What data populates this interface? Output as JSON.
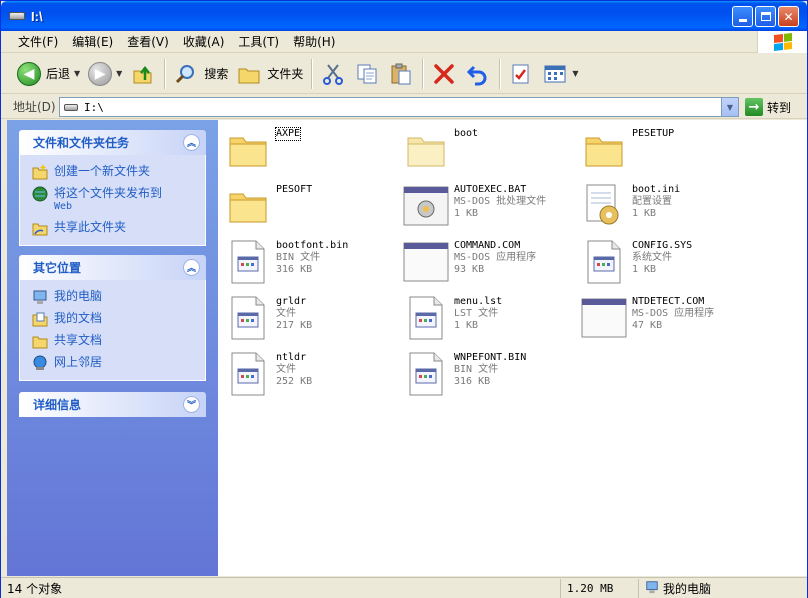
{
  "window": {
    "title": "I:\\"
  },
  "menu": [
    "文件(F)",
    "编辑(E)",
    "查看(V)",
    "收藏(A)",
    "工具(T)",
    "帮助(H)"
  ],
  "toolbar": {
    "back_label": "后退",
    "search_label": "搜索",
    "folders_label": "文件夹"
  },
  "address": {
    "label": "地址(D)",
    "value": "I:\\",
    "go_label": "转到"
  },
  "left": {
    "tasks": {
      "title": "文件和文件夹任务",
      "items": [
        {
          "label": "创建一个新文件夹",
          "sub": "",
          "icon": "new-folder-icon"
        },
        {
          "label": "将这个文件夹发布到",
          "sub": "Web",
          "icon": "publish-web-icon"
        },
        {
          "label": "共享此文件夹",
          "sub": "",
          "icon": "share-folder-icon"
        }
      ]
    },
    "places": {
      "title": "其它位置",
      "items": [
        {
          "label": "我的电脑",
          "icon": "my-computer-icon"
        },
        {
          "label": "我的文档",
          "icon": "my-documents-icon"
        },
        {
          "label": "共享文档",
          "icon": "shared-documents-icon"
        },
        {
          "label": "网上邻居",
          "icon": "network-places-icon"
        }
      ]
    },
    "details": {
      "title": "详细信息"
    }
  },
  "files": [
    {
      "name": "AXPE",
      "type": "",
      "size": "",
      "icon": "folder-icon",
      "focused": true
    },
    {
      "name": "boot",
      "type": "",
      "size": "",
      "icon": "folder-light-icon"
    },
    {
      "name": "PESETUP",
      "type": "",
      "size": "",
      "icon": "folder-icon"
    },
    {
      "name": "PESOFT",
      "type": "",
      "size": "",
      "icon": "folder-icon"
    },
    {
      "name": "AUTOEXEC.BAT",
      "type": "MS-DOS 批处理文件",
      "size": "1 KB",
      "icon": "batch-file-icon"
    },
    {
      "name": "boot.ini",
      "type": "配置设置",
      "size": "1 KB",
      "icon": "config-file-icon"
    },
    {
      "name": "bootfont.bin",
      "type": "BIN 文件",
      "size": "316 KB",
      "icon": "generic-file-icon"
    },
    {
      "name": "COMMAND.COM",
      "type": "MS-DOS 应用程序",
      "size": "93 KB",
      "icon": "dos-app-icon"
    },
    {
      "name": "CONFIG.SYS",
      "type": "系统文件",
      "size": "1 KB",
      "icon": "generic-file-icon"
    },
    {
      "name": "grldr",
      "type": "文件",
      "size": "217 KB",
      "icon": "generic-file-icon"
    },
    {
      "name": "menu.lst",
      "type": "LST 文件",
      "size": "1 KB",
      "icon": "generic-file-icon"
    },
    {
      "name": "NTDETECT.COM",
      "type": "MS-DOS 应用程序",
      "size": "47 KB",
      "icon": "dos-app-icon"
    },
    {
      "name": "ntldr",
      "type": "文件",
      "size": "252 KB",
      "icon": "generic-file-icon"
    },
    {
      "name": "WNPEFONT.BIN",
      "type": "BIN 文件",
      "size": "316 KB",
      "icon": "generic-file-icon"
    }
  ],
  "status": {
    "objects": "14 个对象",
    "size": "1.20 MB",
    "location": "我的电脑"
  },
  "colors": {
    "title_blue": "#0054e3",
    "task_pane": "#7ba2e7",
    "link_blue": "#215dc6"
  }
}
